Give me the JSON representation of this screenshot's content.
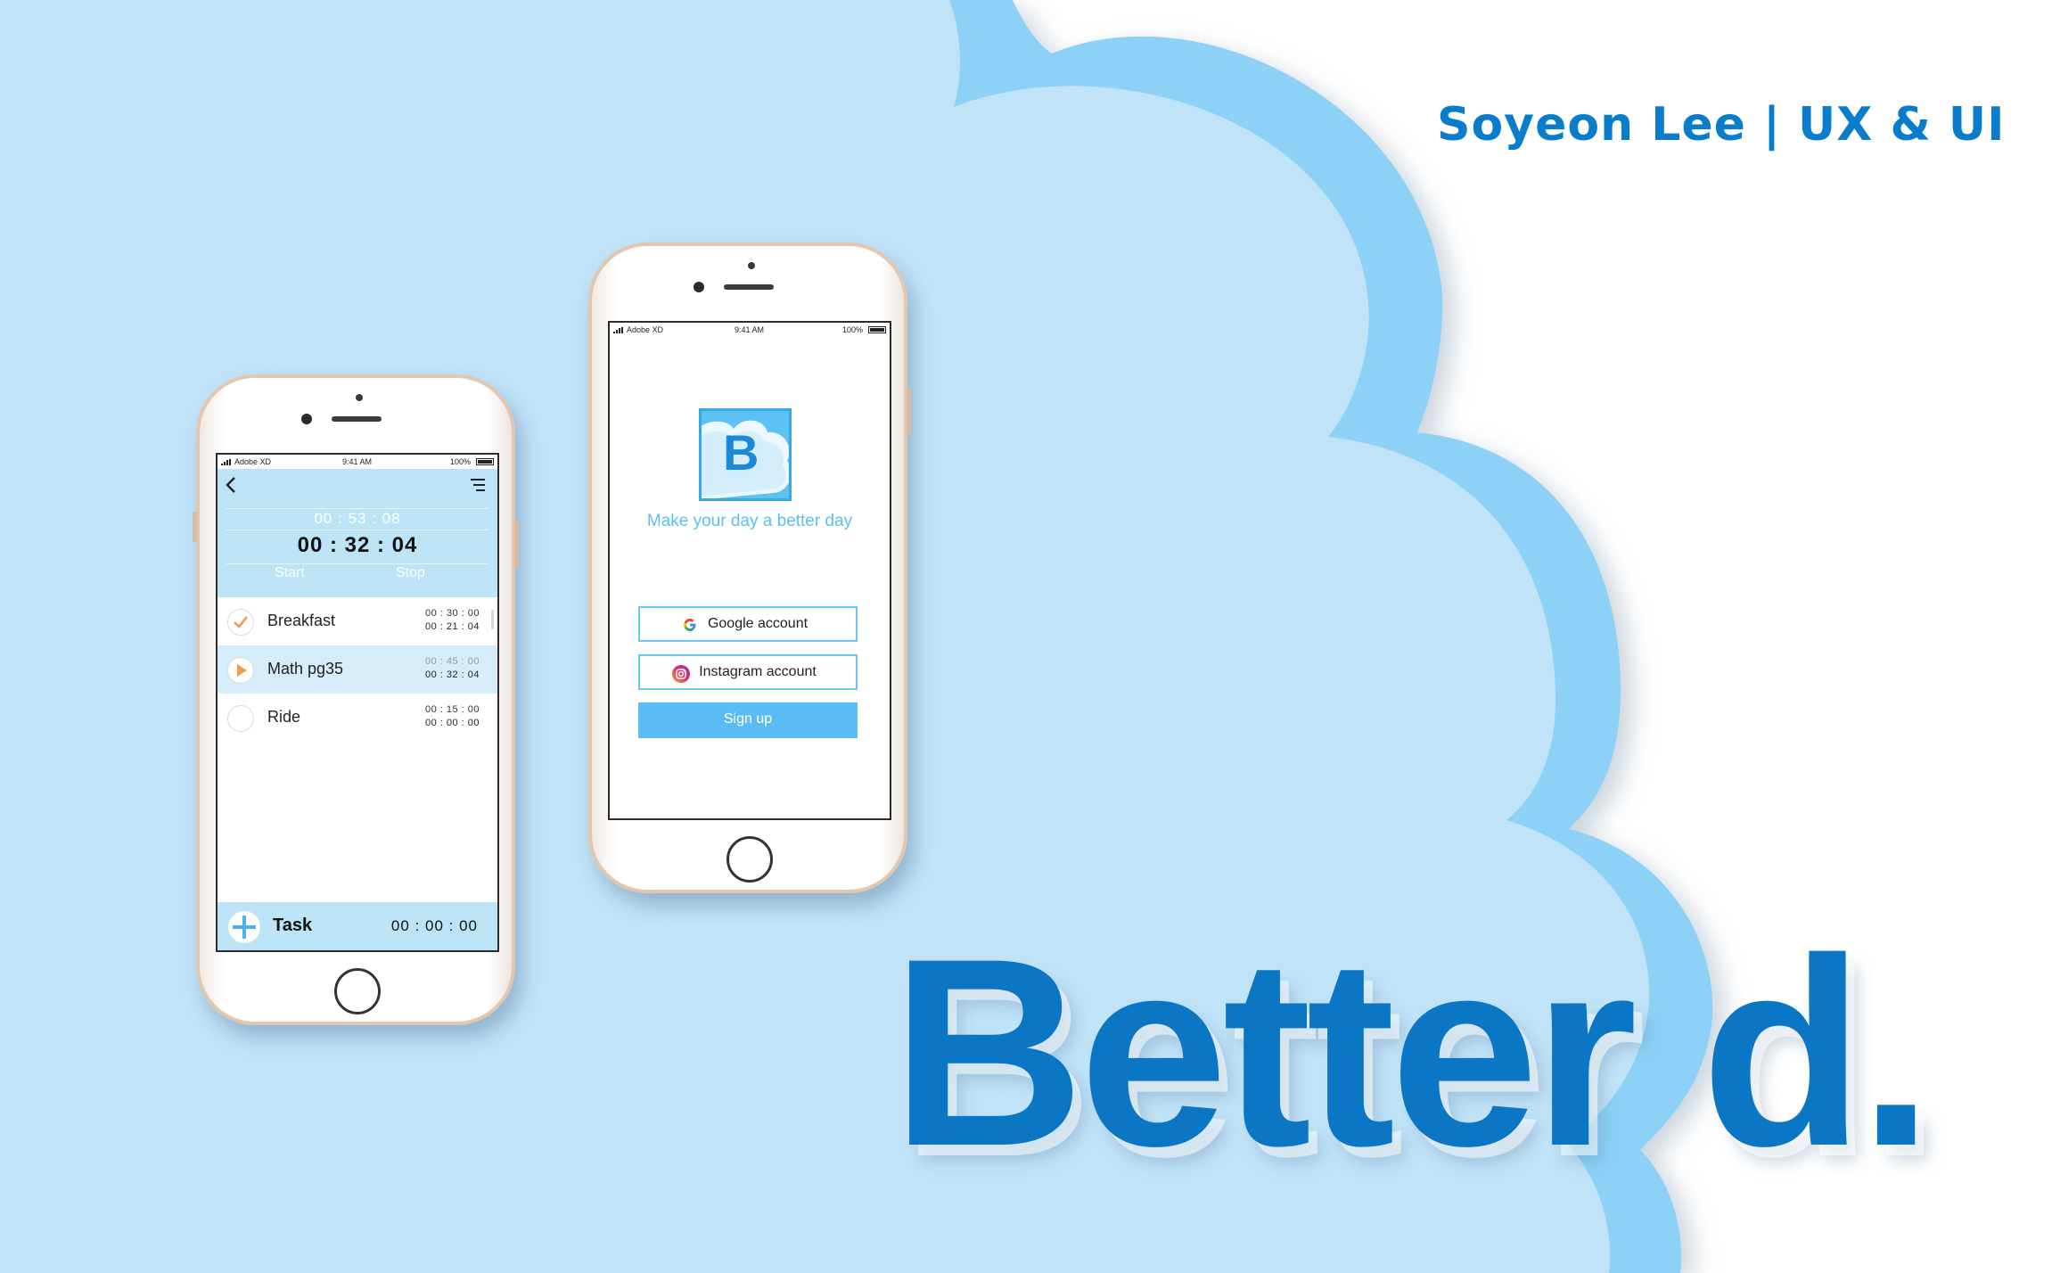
{
  "header": {
    "author": "Soyeon Lee | UX & UI"
  },
  "brand": {
    "title": "Better d."
  },
  "colors": {
    "cloud_light": "#c1e3f8",
    "cloud_edge": "#8ed1f7",
    "brand_blue": "#0a76c4",
    "accent_blue": "#5bbcf4",
    "task_orange": "#f29a4a"
  },
  "phone_timer": {
    "status": {
      "carrier": "Adobe XD",
      "time": "9:41 AM",
      "battery": "100%"
    },
    "icons": {
      "back": "chevron-left-icon",
      "menu": "menu-lines-icon",
      "add": "plus-icon"
    },
    "total_time": "00 : 53 : 08",
    "current_time": "00 : 32 : 04",
    "start_label": "Start",
    "stop_label": "Stop",
    "tasks": [
      {
        "name": "Breakfast",
        "time_set": "00 : 30 : 00",
        "time_used": "00 : 21 : 04",
        "state": "done"
      },
      {
        "name": "Math pg35",
        "time_set": "00 : 45 : 00",
        "time_used": "00 : 32 : 04",
        "state": "playing"
      },
      {
        "name": "Ride",
        "time_set": "00 : 15 : 00",
        "time_used": "00 : 00 : 00",
        "state": "idle"
      }
    ],
    "bottom": {
      "task_label": "Task",
      "time": "00 : 00 : 00"
    }
  },
  "phone_login": {
    "status": {
      "carrier": "Adobe XD",
      "time": "9:41 AM",
      "battery": "100%"
    },
    "logo_letter": "B",
    "tagline": "Make your day a better day",
    "google_label": "Google account",
    "instagram_label": "Instagram account",
    "signup_label": "Sign up"
  }
}
